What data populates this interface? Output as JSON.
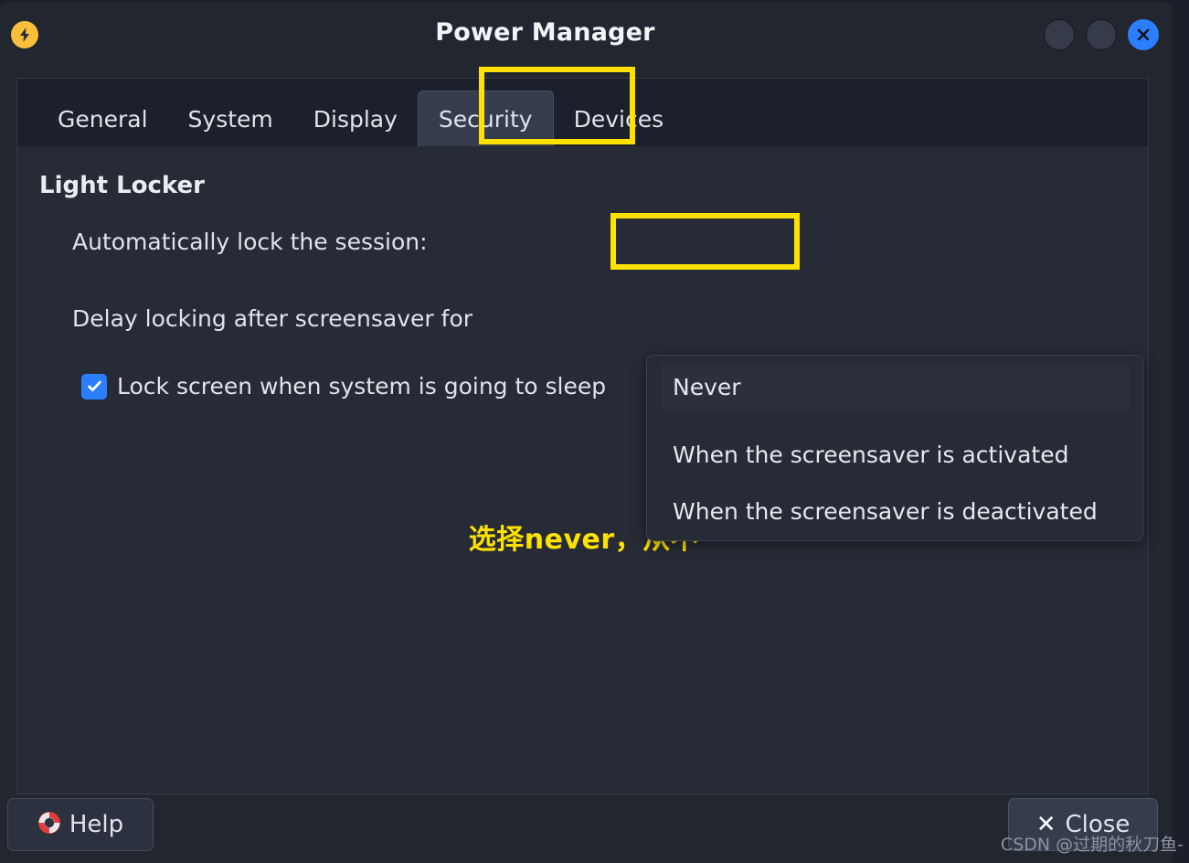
{
  "window": {
    "title": "Power Manager",
    "app_icon": "power-bolt-icon",
    "controls": {
      "minimize": "minimize-button",
      "maximize": "maximize-button",
      "close": "close-window-button"
    }
  },
  "tabs": [
    {
      "label": "General",
      "active": false
    },
    {
      "label": "System",
      "active": false
    },
    {
      "label": "Display",
      "active": false
    },
    {
      "label": "Security",
      "active": true
    },
    {
      "label": "Devices",
      "active": false
    }
  ],
  "content": {
    "section_title": "Light Locker",
    "auto_lock_label": "Automatically lock the session:",
    "delay_label": "Delay locking after screensaver for",
    "sleep_lock": {
      "label": "Lock screen when system is going to sleep",
      "checked": true
    },
    "annotation": "选择never，从不"
  },
  "dropdown": {
    "selected": "Never",
    "options": [
      "Never",
      "When the screensaver is activated",
      "When the screensaver is deactivated"
    ]
  },
  "footer": {
    "help_label": "Help",
    "help_icon": "lifebuoy-icon",
    "close_label": "Close",
    "close_icon": "x-icon"
  },
  "watermark": "CSDN @过期的秋刀鱼-",
  "colors": {
    "accent_blue": "#2b7fff",
    "highlight_yellow": "#ffe100",
    "window_bg": "#22262f",
    "content_bg": "#262b36",
    "tabstrip_bg": "#1c202a"
  }
}
